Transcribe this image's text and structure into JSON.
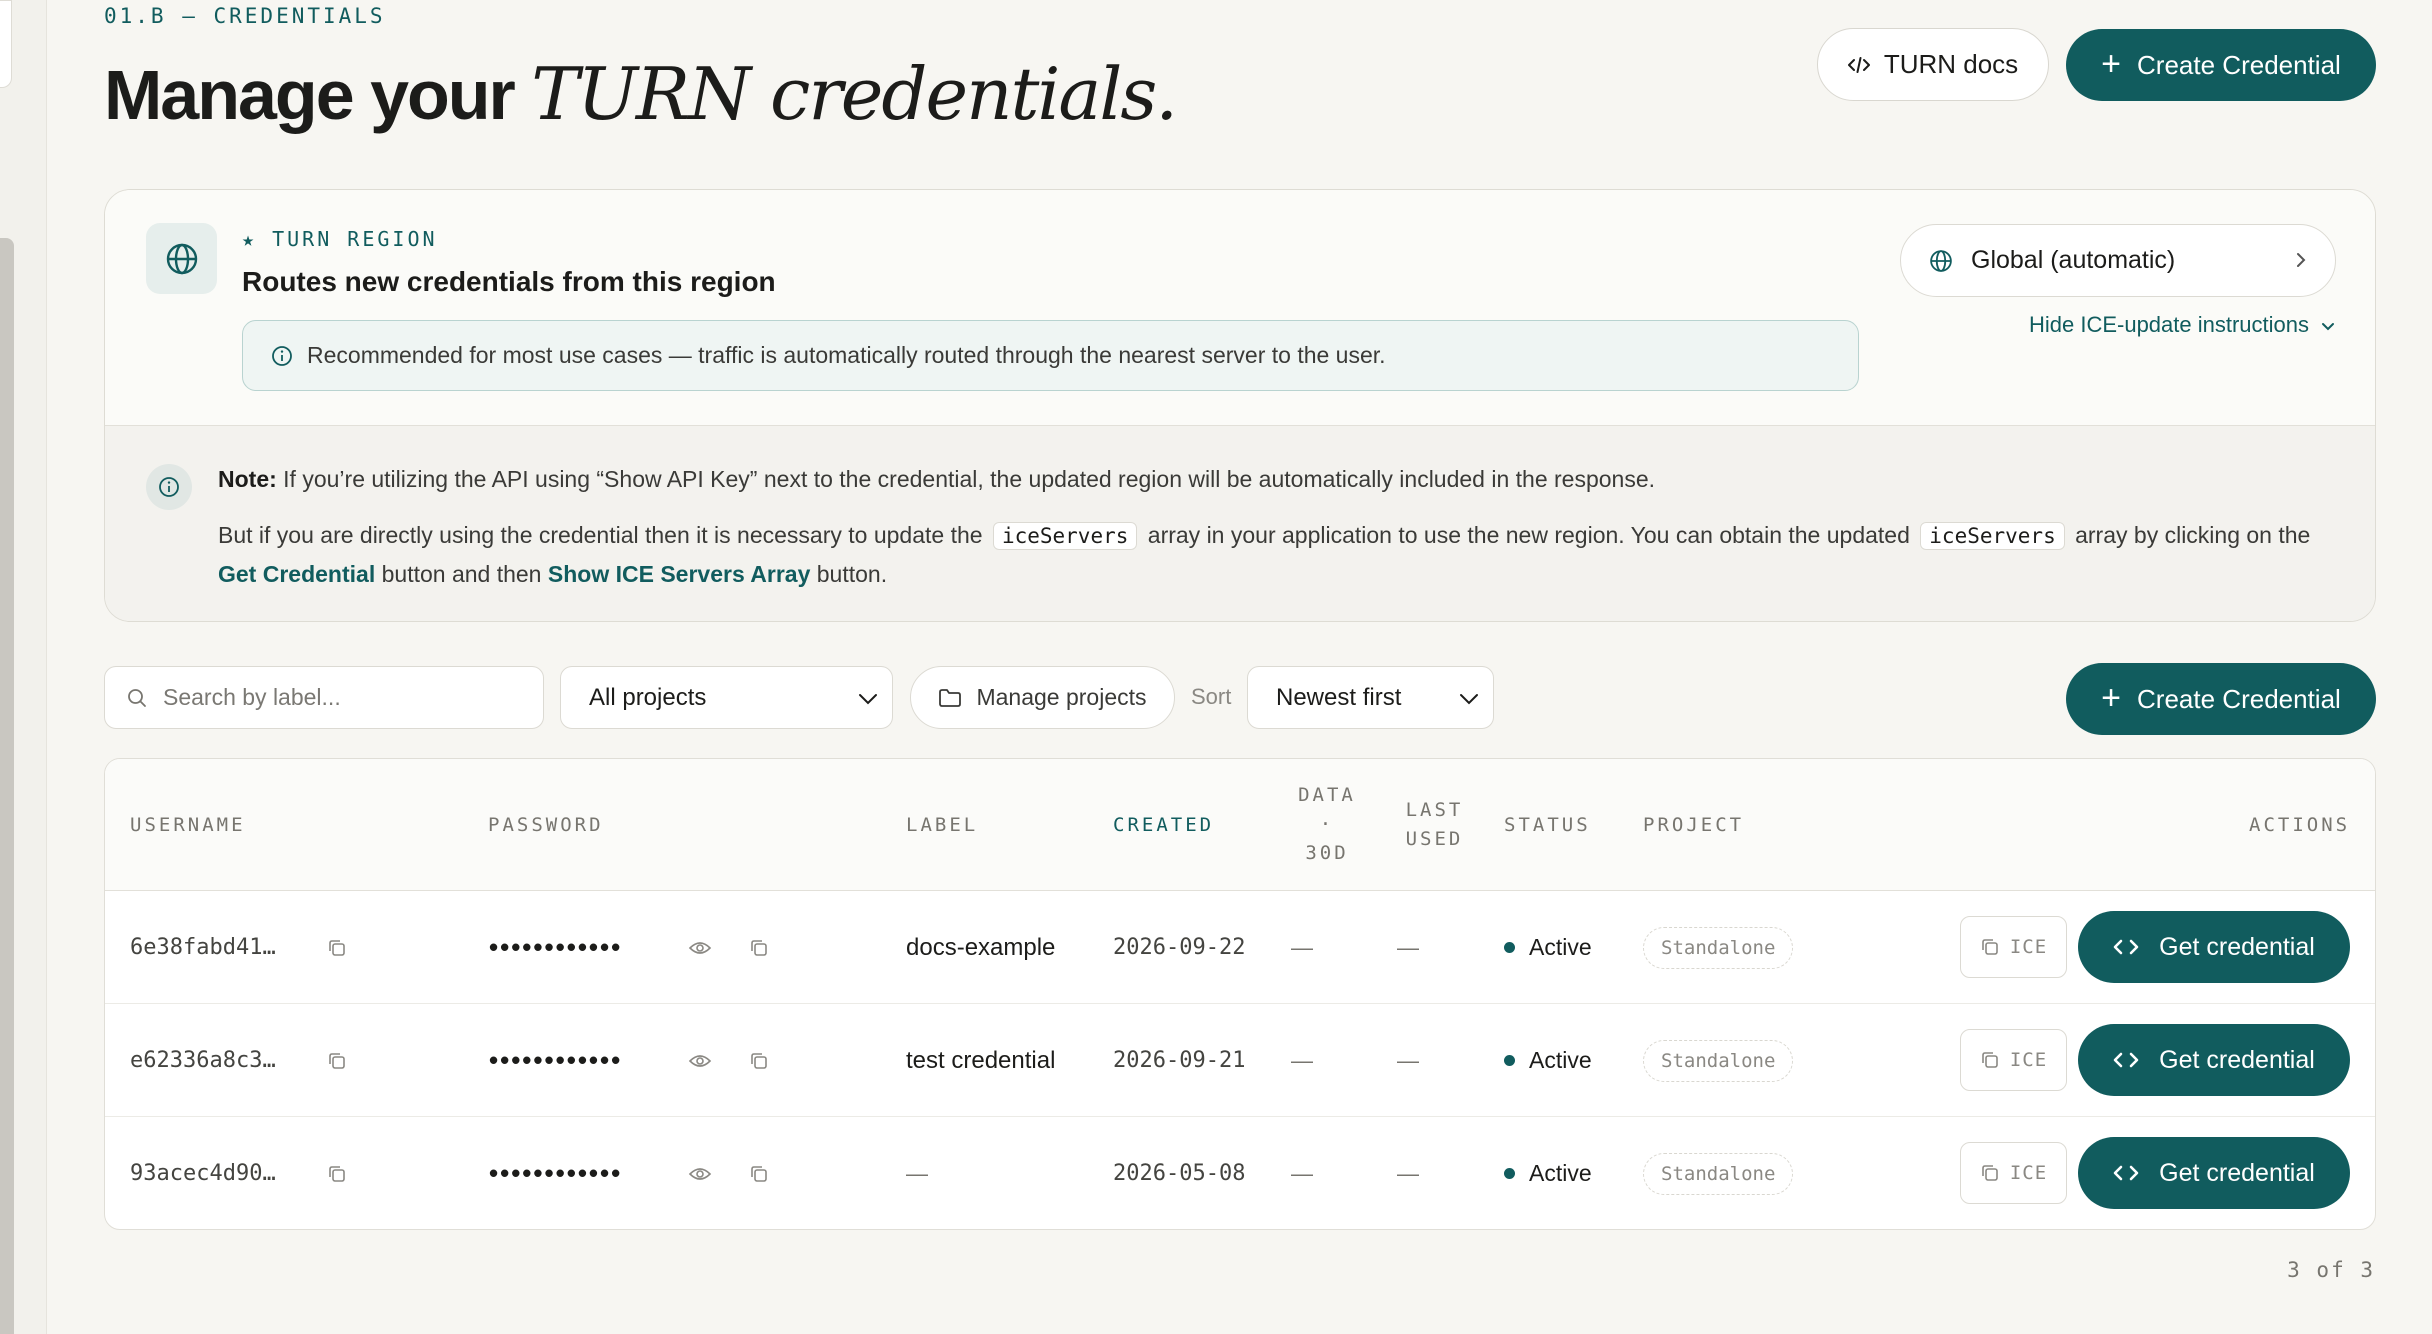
{
  "header": {
    "eyebrow": "01.B — CREDENTIALS",
    "title_plain": "Manage your",
    "title_italic": "TURN credentials.",
    "docs_button": "TURN docs",
    "create_button": "Create Credential"
  },
  "region": {
    "label": "★ TURN REGION",
    "heading": "Routes new credentials from this region",
    "recommendation": "Recommended for most use cases — traffic is automatically routed through the nearest server to the user.",
    "selected": "Global (automatic)",
    "hide_link": "Hide ICE-update instructions",
    "note_label": "Note:",
    "note_text": "If you’re utilizing the API using “Show API Key” next to the credential, the updated region will be automatically included in the response.",
    "note2_a": "But if you are directly using the credential then it is necessary to update the",
    "note2_code1": "iceServers",
    "note2_b": "array in your application to use the new region. You can obtain the updated",
    "note2_code2": "iceServers",
    "note2_c": "array by clicking on the",
    "note2_link1": "Get Credential",
    "note2_d": "button and then",
    "note2_link2": "Show ICE Servers Array",
    "note2_e": "button."
  },
  "toolbar": {
    "search_placeholder": "Search by label...",
    "project_filter": "All projects",
    "manage_projects": "Manage projects",
    "sort_label": "Sort",
    "sort_value": "Newest first",
    "create_button": "Create Credential"
  },
  "table": {
    "headers": {
      "username": "USERNAME",
      "password": "PASSWORD",
      "label": "LABEL",
      "created": "CREATED",
      "data_1": "DATA",
      "data_2": "·",
      "data_3": "30D",
      "last_1": "LAST",
      "last_2": "USED",
      "status": "STATUS",
      "project": "PROJECT",
      "actions": "ACTIONS"
    },
    "rows": [
      {
        "username": "6e38fabd41…",
        "password": "••••••••••••",
        "label": "docs-example",
        "created": "2026-09-22",
        "data": "—",
        "last_used": "—",
        "status": "Active",
        "project": "Standalone",
        "ice": "ICE",
        "action": "Get credential"
      },
      {
        "username": "e62336a8c3…",
        "password": "••••••••••••",
        "label": "test credential",
        "created": "2026-09-21",
        "data": "—",
        "last_used": "—",
        "status": "Active",
        "project": "Standalone",
        "ice": "ICE",
        "action": "Get credential"
      },
      {
        "username": "93acec4d90…",
        "password": "••••••••••••",
        "label": "—",
        "created": "2026-05-08",
        "data": "—",
        "last_used": "—",
        "status": "Active",
        "project": "Standalone",
        "ice": "ICE",
        "action": "Get credential"
      }
    ]
  },
  "footer": {
    "count": "3 of 3"
  },
  "colors": {
    "accent": "#115c5e",
    "background": "#f7f6f2"
  },
  "icons": [
    "code-icon",
    "plus-icon",
    "globe-icon",
    "info-icon",
    "chevron-right-icon",
    "chevron-down-icon",
    "search-icon",
    "folder-icon",
    "copy-icon",
    "eye-icon"
  ]
}
